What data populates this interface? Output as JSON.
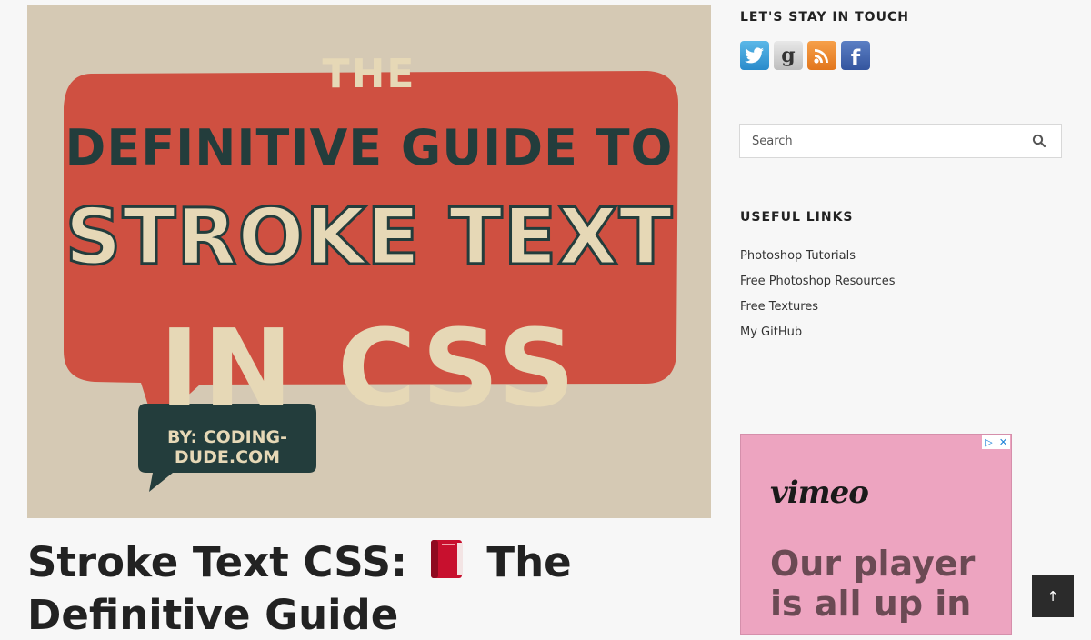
{
  "hero": {
    "line_the": "THE",
    "line_guide": "DEFINITIVE GUIDE TO",
    "line_stroke": "STROKE TEXT",
    "line_incss": "IN CSS",
    "byline": "BY: CODING-DUDE.COM",
    "bubble_color": "#cf5041",
    "byline_box_color": "#233d3c"
  },
  "post": {
    "title_part1": "Stroke Text CSS:",
    "title_icon": "book-icon",
    "title_part2": "The Definitive Guide"
  },
  "sidebar": {
    "stay_in_touch_title": "LET'S STAY IN TOUCH",
    "social_icons": [
      "twitter-icon",
      "goodreads-icon",
      "rss-icon",
      "facebook-icon"
    ],
    "search": {
      "placeholder": "Search",
      "value": ""
    },
    "useful_links_title": "USEFUL LINKS",
    "useful_links": [
      "Photoshop Tutorials",
      "Free Photoshop Resources",
      "Free Textures",
      "My GitHub"
    ]
  },
  "ad": {
    "brand": "vimeo",
    "headline": "Our player is all up in",
    "background": "#eda4c0"
  },
  "scroll_top": {
    "icon": "arrow-up-icon",
    "glyph": "↑"
  }
}
